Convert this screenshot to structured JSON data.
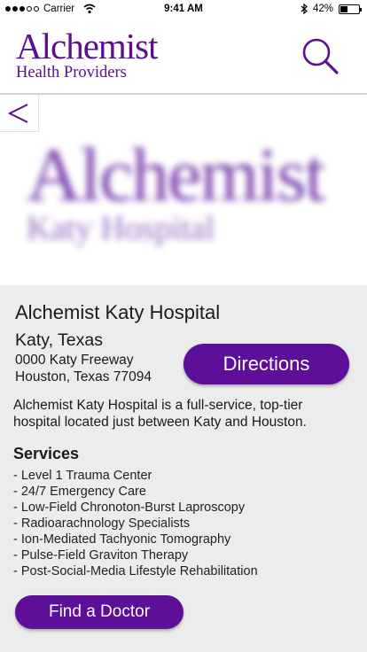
{
  "status_bar": {
    "carrier": "Carrier",
    "time": "9:41 AM",
    "battery": "42%",
    "battery_level": 0.42,
    "icons": [
      "signal-dots-icon",
      "wifi-icon",
      "bluetooth-icon",
      "battery-icon"
    ]
  },
  "header": {
    "brand_title": "Alchemist",
    "brand_subtitle": "Health Providers",
    "search_icon": "search-icon"
  },
  "hero": {
    "logo_title": "Alchemist",
    "logo_subtitle": "Katy Hospital",
    "back_icon": "chevron-left-icon"
  },
  "hospital": {
    "name": "Alchemist Katy Hospital",
    "city": "Katy, Texas",
    "address_line1": "0000 Katy Freeway",
    "address_line2": "Houston, Texas 77094",
    "directions_label": "Directions",
    "description": "Alchemist Katy Hospital is a full-service, top-tier hospital located just between Katy and Houston."
  },
  "services": {
    "title": "Services",
    "items": [
      "- Level 1 Trauma Center",
      "- 24/7 Emergency Care",
      "- Low-Field Chronoton-Burst Laproscopy",
      "- Radioarachnology Specialists",
      "- Ion-Mediated Tachyonic Tomography",
      "- Pulse-Field Graviton Therapy",
      "- Post-Social-Media Lifestyle Rehabilitation"
    ]
  },
  "find_doctor_label": "Find a Doctor",
  "colors": {
    "brand_purple": "#5e0f99",
    "background": "#ececec"
  }
}
